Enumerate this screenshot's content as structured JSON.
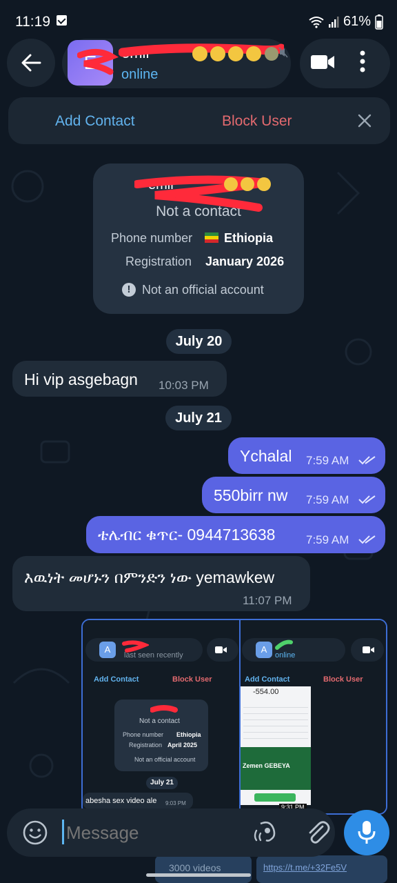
{
  "status_bar": {
    "time": "11:19",
    "battery": "61%",
    "wifi_icon": "wifi-icon",
    "signal_icon": "signal-icon"
  },
  "header": {
    "back_icon": "arrow-left-icon",
    "avatar_letter": "E",
    "contact_name": "emir",
    "contact_status": "online",
    "video_icon": "video-camera-icon",
    "more_icon": "more-vertical-icon"
  },
  "contact_bar": {
    "add_label": "Add Contact",
    "block_label": "Block User",
    "close_icon": "close-icon"
  },
  "info_card": {
    "name": "emir",
    "subtitle": "Not a contact",
    "phone_label": "Phone number",
    "phone_value": "Ethiopia",
    "reg_label": "Registration",
    "reg_value": "January 2026",
    "official_text": "Not an official account"
  },
  "messages": [
    {
      "type": "date",
      "text": "July 20"
    },
    {
      "type": "in",
      "text": "Hi vip asgebagn",
      "time": "10:03 PM"
    },
    {
      "type": "date",
      "text": "July 21"
    },
    {
      "type": "out",
      "text": "Ychalal",
      "time": "7:59 AM"
    },
    {
      "type": "out",
      "text": "550birr nw",
      "time": "7:59 AM"
    },
    {
      "type": "out",
      "text": "ቴሌብር ቁጥር- 0944713638",
      "time": "7:59 AM"
    },
    {
      "type": "in",
      "text": "እዉነት መሆኑን በምንድን ነው yemawkew",
      "time": "11:07 PM"
    }
  ],
  "media_left": {
    "last_seen": "last seen recently",
    "add_label": "Add Contact",
    "block_label": "Block User",
    "not_contact": "Not a contact",
    "phone_label": "Phone number",
    "phone_value": "Ethiopia",
    "reg_label": "Registration",
    "reg_value": "April 2025",
    "official_text": "Not an official account",
    "date": "July 21",
    "msg": "abesha sex video ale",
    "msg_time": "9:03 PM"
  },
  "media_right": {
    "status": "online",
    "add_label": "Add Contact",
    "block_label": "Block User",
    "amount": "-554.00",
    "bank": "Zemen GEBEYA",
    "time": "9:31 PM"
  },
  "below_media": {
    "left_text": "3000 videos",
    "right_text": "https://t.me/+32Fe5V"
  },
  "input": {
    "placeholder": "Message",
    "emoji_icon": "emoji-icon",
    "sticker_icon": "sticker-icon",
    "attach_icon": "paperclip-icon",
    "mic_icon": "microphone-icon"
  },
  "colors": {
    "background": "#0f1823",
    "out_bubble": "#5a64e3",
    "in_bubble": "#202c39",
    "accent_blue": "#62b3ee",
    "danger": "#e36a6f"
  }
}
